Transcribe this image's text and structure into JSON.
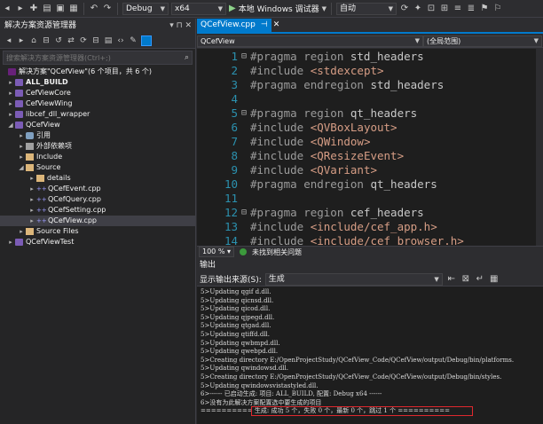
{
  "toolbar": {
    "config": "Debug",
    "platform": "x64",
    "run_label": "本地 Windows 调试器",
    "mode": "自动"
  },
  "solution_explorer": {
    "title": "解决方案资源管理器",
    "search_placeholder": "搜索解决方案资源管理器(Ctrl+;)",
    "solution_label": "解决方案\"QCefView\"(6 个项目，共 6 个)",
    "items": [
      {
        "label": "ALL_BUILD",
        "bold": true
      },
      {
        "label": "CefViewCore"
      },
      {
        "label": "CefViewWing"
      },
      {
        "label": "libcef_dll_wrapper"
      },
      {
        "label": "QCefView"
      },
      {
        "label": "引用"
      },
      {
        "label": "外部依赖项"
      },
      {
        "label": "Include"
      },
      {
        "label": "Source"
      },
      {
        "label": "details"
      },
      {
        "label": "QCefEvent.cpp"
      },
      {
        "label": "QCefQuery.cpp"
      },
      {
        "label": "QCefSetting.cpp"
      },
      {
        "label": "QCefView.cpp"
      },
      {
        "label": "Source Files"
      },
      {
        "label": "QCefViewTest"
      }
    ]
  },
  "editor": {
    "tab_label": "QCefView.cpp",
    "nav_left": "QCefView",
    "nav_right": "(全局范围)",
    "lines": [
      {
        "n": "1",
        "fold": "⊟",
        "text": "#pragma region std_headers",
        "kind": "dir"
      },
      {
        "n": "2",
        "fold": "",
        "text": "#include <stdexcept>",
        "kind": "inc"
      },
      {
        "n": "3",
        "fold": "",
        "text": "#pragma endregion std_headers",
        "kind": "dir"
      },
      {
        "n": "4",
        "fold": "",
        "text": "",
        "kind": "dir"
      },
      {
        "n": "5",
        "fold": "⊟",
        "text": "#pragma region qt_headers",
        "kind": "dir"
      },
      {
        "n": "6",
        "fold": "",
        "text": "#include <QVBoxLayout>",
        "kind": "inc"
      },
      {
        "n": "7",
        "fold": "",
        "text": "#include <QWindow>",
        "kind": "inc"
      },
      {
        "n": "8",
        "fold": "",
        "text": "#include <QResizeEvent>",
        "kind": "inc"
      },
      {
        "n": "9",
        "fold": "",
        "text": "#include <QVariant>",
        "kind": "inc"
      },
      {
        "n": "10",
        "fold": "",
        "text": "#pragma endregion qt_headers",
        "kind": "dir"
      },
      {
        "n": "11",
        "fold": "",
        "text": "",
        "kind": "dir"
      },
      {
        "n": "12",
        "fold": "⊟",
        "text": "#pragma region cef_headers",
        "kind": "dir"
      },
      {
        "n": "13",
        "fold": "",
        "text": "#include <include/cef_app.h>",
        "kind": "inc"
      },
      {
        "n": "14",
        "fold": "",
        "text": "#include <include/cef_browser.h>",
        "kind": "inc"
      }
    ],
    "zoom": "100 %",
    "status": "未找到相关问题"
  },
  "output": {
    "title": "输出",
    "source_label": "显示输出来源(S):",
    "source_value": "生成",
    "lines": [
      "5>Updating qgif d.dll.",
      "5>Updating qicnsd.dll.",
      "5>Updating qicod.dll.",
      "5>Updating qjpegd.dll.",
      "5>Updating qtgad.dll.",
      "5>Updating qtiffd.dll.",
      "5>Updating qwbmpd.dll.",
      "5>Updating qwebpd.dll.",
      "5>Creating directory E:/OpenProjectStudy/QCefView_Code/QCefView/output/Debug/bin/platforms.",
      "5>Updating qwindowsd.dll.",
      "5>Creating directory E:/OpenProjectStudy/QCefView_Code/QCefView/output/Debug/bin/styles.",
      "5>Updating qwindowsvistastyled.dll.",
      "6>------ 已启动生成: 项目: ALL_BUILD, 配置: Debug x64 ------",
      "6>没有为此解决方案配置选中要生成的项目"
    ],
    "final_prefix": "==========",
    "final_line": "生成: 成功 5 个，失败 0 个，最新 0 个，跳过 1 个 =========="
  }
}
